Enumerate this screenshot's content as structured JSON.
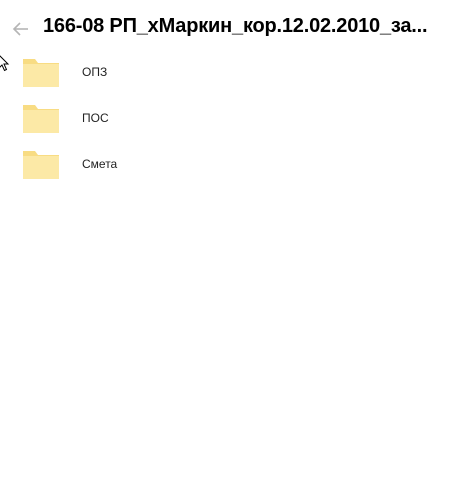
{
  "header": {
    "title": "166-08 РП_хМаркин_кор.12.02.2010_за...",
    "back_icon": "arrow-left-icon"
  },
  "folders": [
    {
      "label": "ОПЗ",
      "icon": "folder-icon"
    },
    {
      "label": "ПОС",
      "icon": "folder-icon"
    },
    {
      "label": "Смета",
      "icon": "folder-icon"
    }
  ],
  "colors": {
    "folder_body": "#FCE9A6",
    "folder_tab": "#F8DC83",
    "back_arrow": "#B5B5B5"
  }
}
